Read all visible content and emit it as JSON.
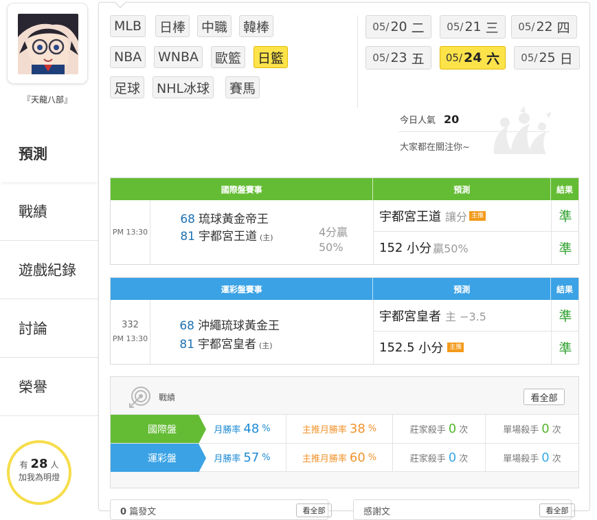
{
  "user": {
    "name": "『天龍八部』"
  },
  "sidebar": {
    "items": [
      {
        "label": "預測"
      },
      {
        "label": "戰績"
      },
      {
        "label": "遊戲紀錄"
      },
      {
        "label": "討論"
      },
      {
        "label": "榮譽"
      }
    ],
    "fans": {
      "prefix": "有",
      "count": "28",
      "suffix": "人",
      "note": "加我為明燈"
    }
  },
  "leagues": [
    "MLB",
    "日棒",
    "中職",
    "韓棒",
    "NBA",
    "WNBA",
    "歐籃",
    "日籃",
    "足球",
    "NHL冰球",
    "賽馬"
  ],
  "active_league": "日籃",
  "dates": [
    {
      "md": "05/",
      "d": "20",
      "w": "二"
    },
    {
      "md": "05/",
      "d": "21",
      "w": "三"
    },
    {
      "md": "05/",
      "d": "22",
      "w": "四"
    },
    {
      "md": "05/",
      "d": "23",
      "w": "五"
    },
    {
      "md": "05/",
      "d": "24",
      "w": "六"
    },
    {
      "md": "05/",
      "d": "25",
      "w": "日"
    }
  ],
  "active_date": "24",
  "popularity": {
    "label": "今日人氣",
    "value": "20",
    "note": "大家都在關注你~"
  },
  "intl_table": {
    "headers": {
      "game": "國際盤賽事",
      "pred": "預測",
      "result": "結果"
    },
    "time": "PM 13:30",
    "away": {
      "score": "68",
      "name": "琉球黃金帝王"
    },
    "home": {
      "score": "81",
      "name": "宇都宮王道",
      "host": "(主)"
    },
    "extra": {
      "line1": "4分贏",
      "line2": "50%"
    },
    "pred1": {
      "team": "宇都宮王道",
      "type": "讓分",
      "tag": "主推"
    },
    "pred2": {
      "value": "152",
      "type": "小分",
      "note": "贏50%"
    },
    "results": [
      "準",
      "準"
    ]
  },
  "lottery_table": {
    "headers": {
      "game": "運彩盤賽事",
      "pred": "預測",
      "result": "結果"
    },
    "number": "332",
    "time": "PM 13:30",
    "away": {
      "score": "68",
      "name": "沖繩琉球黃金王"
    },
    "home": {
      "score": "81",
      "name": "宇都宮皇者",
      "host": "(主)"
    },
    "pred1": {
      "team": "宇都宮皇者",
      "detail": "主 −3.5"
    },
    "pred2": {
      "value": "152.5",
      "type": "小分",
      "tag": "主推"
    },
    "results": [
      "準",
      "準"
    ]
  },
  "record": {
    "title": "戰績",
    "view_all": "看全部",
    "rows": [
      {
        "label": "國際盤",
        "month_label": "月勝率",
        "month_rate": "48",
        "main_label": "主推月勝率",
        "main_rate": "38",
        "pct": "%",
        "banker_label": "莊家殺手",
        "banker": "0",
        "single_label": "單場殺手",
        "single": "0",
        "unit": "次"
      },
      {
        "label": "運彩盤",
        "month_label": "月勝率",
        "month_rate": "57",
        "main_label": "主推月勝率",
        "main_rate": "60",
        "pct": "%",
        "banker_label": "莊家殺手",
        "banker": "0",
        "single_label": "單場殺手",
        "single": "0",
        "unit": "次"
      }
    ]
  },
  "bottom": {
    "left": {
      "count": "0",
      "label": "篇發文",
      "button": "看全部"
    },
    "right": {
      "label": "感謝文",
      "button": "看全部"
    }
  },
  "colors": {
    "green": "#64bc34",
    "blue": "#3aa2e5",
    "yellow": "#fde34a",
    "result": "#2fa12f"
  }
}
